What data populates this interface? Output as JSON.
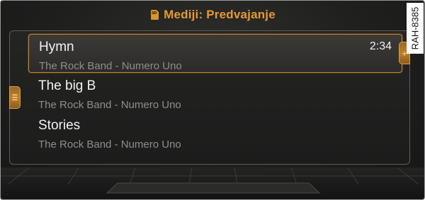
{
  "header": {
    "icon": "sd-card-icon",
    "icon_text": "SD",
    "title": "Mediji: Predvajanje"
  },
  "tracks": [
    {
      "title": "Hymn",
      "subtitle": "The Rock Band - Numero Uno",
      "duration": "2:34",
      "selected": true
    },
    {
      "title": "The big B",
      "subtitle": "The Rock Band - Numero Uno"
    },
    {
      "title": "Stories",
      "subtitle": "The Rock Band - Numero Uno"
    }
  ],
  "side_tabs": {
    "left_icon": "menu-icon",
    "right_icon": "plus-icon",
    "right_glyph": "+"
  },
  "figure_label": "RAH-8385",
  "colors": {
    "accent": "#e69a31",
    "text_primary": "#f2f2f2",
    "text_secondary": "#8e8e8c",
    "background": "#1f1f1e"
  }
}
